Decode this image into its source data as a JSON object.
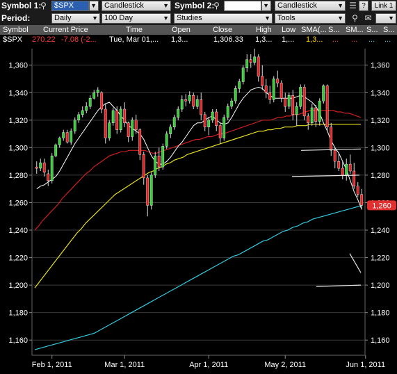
{
  "toolbar": {
    "symbol1_label": "Symbol 1:",
    "symbol1_value": "$SPX",
    "chart_type1": "Candlestick",
    "symbol2_label": "Symbol 2:",
    "symbol2_value": "",
    "chart_type2": "Candlestick",
    "link_label": "Link 1",
    "help_label": "?",
    "period_label": "Period:",
    "period_value": "Daily",
    "range_value": "100 Day",
    "studies_value": "Studies",
    "tools_value": "Tools"
  },
  "quote_header": [
    "Symbol",
    "Current Price",
    "Time",
    "Open",
    "Close",
    "High",
    "Low",
    "SMA(...",
    "S...",
    "SM...",
    "S...",
    "S..."
  ],
  "quote_row": {
    "symbol": "$SPX",
    "price": "270.22",
    "change": "-7.08 (-2...",
    "time": "Tue, Mar 01,...",
    "open": "1,3...",
    "close": "1,306.33",
    "high": "1,3...",
    "low": "1,...",
    "sma": "1,3...",
    "s1": "...",
    "sm": "...",
    "s2": "...",
    "s3": "..."
  },
  "colors": {
    "up": "#33cc33",
    "down": "#e02020",
    "sma_white": "#ffffff",
    "sma_red": "#cc1f1f",
    "sma_yellow": "#e6e020",
    "sma_cyan": "#33cce0",
    "price_tag": "#e03030",
    "negative_text": "#ff3b3b",
    "sma_header_text": "#ffd000"
  },
  "chart_data": {
    "type": "candlestick",
    "y_ticks": [
      1160,
      1180,
      1200,
      1220,
      1240,
      1260,
      1280,
      1300,
      1320,
      1340,
      1360
    ],
    "y_tick_labels": [
      "1,160",
      "1,180",
      "1,200",
      "1,220",
      "1,240",
      "1,260",
      "1,280",
      "1,300",
      "1,320",
      "1,340",
      "1,360"
    ],
    "ylim": [
      1150,
      1372
    ],
    "grid": true,
    "x_tick_labels": [
      {
        "label": "Feb 1, 2011",
        "bar": 4
      },
      {
        "label": "Mar 1, 2011",
        "bar": 23
      },
      {
        "label": "Apr 1, 2011",
        "bar": 45
      },
      {
        "label": "May 2, 2011",
        "bar": 65
      },
      {
        "label": "Jun 1, 2011",
        "bar": 86
      }
    ],
    "last_price_label": "1,260",
    "last_price": 1258,
    "candles": [
      [
        1286,
        1290,
        1281,
        1285
      ],
      [
        1285,
        1292,
        1283,
        1289
      ],
      [
        1289,
        1292,
        1279,
        1282
      ],
      [
        1281,
        1284,
        1272,
        1276
      ],
      [
        1276,
        1296,
        1274,
        1294
      ],
      [
        1294,
        1303,
        1293,
        1302
      ],
      [
        1302,
        1308,
        1300,
        1307
      ],
      [
        1307,
        1313,
        1305,
        1311
      ],
      [
        1311,
        1313,
        1303,
        1304
      ],
      [
        1304,
        1314,
        1302,
        1312
      ],
      [
        1312,
        1322,
        1310,
        1320
      ],
      [
        1320,
        1326,
        1318,
        1324
      ],
      [
        1324,
        1330,
        1322,
        1327
      ],
      [
        1327,
        1333,
        1325,
        1330
      ],
      [
        1330,
        1338,
        1328,
        1336
      ],
      [
        1336,
        1342,
        1335,
        1340
      ],
      [
        1340,
        1344,
        1337,
        1342
      ],
      [
        1340,
        1341,
        1325,
        1328
      ],
      [
        1328,
        1332,
        1303,
        1307
      ],
      [
        1307,
        1320,
        1305,
        1318
      ],
      [
        1318,
        1329,
        1316,
        1327
      ],
      [
        1327,
        1330,
        1310,
        1313
      ],
      [
        1313,
        1330,
        1311,
        1328
      ],
      [
        1328,
        1333,
        1315,
        1318
      ],
      [
        1318,
        1319,
        1304,
        1308
      ],
      [
        1308,
        1322,
        1305,
        1320
      ],
      [
        1320,
        1324,
        1310,
        1313
      ],
      [
        1313,
        1314,
        1291,
        1295
      ],
      [
        1295,
        1297,
        1273,
        1278
      ],
      [
        1278,
        1280,
        1250,
        1258
      ],
      [
        1258,
        1282,
        1255,
        1280
      ],
      [
        1280,
        1297,
        1278,
        1294
      ],
      [
        1294,
        1300,
        1283,
        1286
      ],
      [
        1286,
        1303,
        1284,
        1301
      ],
      [
        1301,
        1312,
        1299,
        1310
      ],
      [
        1310,
        1317,
        1307,
        1315
      ],
      [
        1315,
        1324,
        1313,
        1322
      ],
      [
        1322,
        1330,
        1320,
        1328
      ],
      [
        1328,
        1338,
        1326,
        1335
      ],
      [
        1335,
        1339,
        1330,
        1334
      ],
      [
        1334,
        1341,
        1332,
        1338
      ],
      [
        1338,
        1340,
        1328,
        1330
      ],
      [
        1330,
        1338,
        1328,
        1335
      ],
      [
        1335,
        1340,
        1320,
        1324
      ],
      [
        1324,
        1326,
        1312,
        1315
      ],
      [
        1315,
        1322,
        1309,
        1320
      ],
      [
        1320,
        1328,
        1318,
        1326
      ],
      [
        1326,
        1328,
        1312,
        1316
      ],
      [
        1316,
        1318,
        1303,
        1307
      ],
      [
        1307,
        1324,
        1305,
        1322
      ],
      [
        1322,
        1332,
        1320,
        1330
      ],
      [
        1330,
        1336,
        1328,
        1334
      ],
      [
        1334,
        1345,
        1332,
        1343
      ],
      [
        1343,
        1350,
        1340,
        1348
      ],
      [
        1348,
        1360,
        1346,
        1358
      ],
      [
        1358,
        1368,
        1355,
        1364
      ],
      [
        1364,
        1368,
        1358,
        1362
      ],
      [
        1362,
        1372,
        1360,
        1366
      ],
      [
        1366,
        1368,
        1348,
        1352
      ],
      [
        1352,
        1360,
        1342,
        1345
      ],
      [
        1345,
        1350,
        1336,
        1340
      ],
      [
        1340,
        1345,
        1332,
        1335
      ],
      [
        1335,
        1352,
        1333,
        1350
      ],
      [
        1350,
        1356,
        1344,
        1347
      ],
      [
        1347,
        1349,
        1333,
        1336
      ],
      [
        1336,
        1340,
        1326,
        1330
      ],
      [
        1330,
        1340,
        1328,
        1338
      ],
      [
        1338,
        1342,
        1320,
        1324
      ],
      [
        1324,
        1333,
        1316,
        1330
      ],
      [
        1330,
        1346,
        1328,
        1344
      ],
      [
        1344,
        1346,
        1320,
        1323
      ],
      [
        1323,
        1325,
        1313,
        1318
      ],
      [
        1318,
        1332,
        1316,
        1329
      ],
      [
        1329,
        1331,
        1315,
        1319
      ],
      [
        1319,
        1336,
        1316,
        1334
      ],
      [
        1334,
        1346,
        1332,
        1345
      ],
      [
        1345,
        1346,
        1312,
        1315
      ],
      [
        1315,
        1318,
        1294,
        1298
      ],
      [
        1298,
        1300,
        1285,
        1290
      ],
      [
        1290,
        1296,
        1283,
        1285
      ],
      [
        1285,
        1290,
        1277,
        1280
      ],
      [
        1280,
        1292,
        1276,
        1288
      ],
      [
        1288,
        1295,
        1281,
        1283
      ],
      [
        1283,
        1289,
        1270,
        1272
      ],
      [
        1272,
        1275,
        1264,
        1266
      ],
      [
        1266,
        1270,
        1256,
        1258
      ]
    ],
    "sma_white": [
      1270,
      1272,
      1273,
      1275,
      1277,
      1279,
      1283,
      1288,
      1293,
      1298,
      1303,
      1307,
      1311,
      1315,
      1319,
      1323,
      1327,
      1330,
      1332,
      1333,
      1330,
      1327,
      1323,
      1320,
      1316,
      1314,
      1312,
      1310,
      1306,
      1300,
      1294,
      1290,
      1288,
      1288,
      1290,
      1293,
      1297,
      1301,
      1304,
      1308,
      1312,
      1316,
      1318,
      1318,
      1320,
      1322,
      1323,
      1320,
      1318,
      1317,
      1318,
      1322,
      1327,
      1332,
      1336,
      1339,
      1342,
      1343,
      1344,
      1343,
      1340,
      1338,
      1336,
      1336,
      1336,
      1336,
      1336,
      1336,
      1337,
      1338,
      1337,
      1335,
      1333,
      1330,
      1325,
      1318,
      1312,
      1305,
      1300,
      1296,
      1290,
      1284,
      1276,
      1268,
      1262,
      1255
    ],
    "sma_red": [
      1240,
      1243,
      1247,
      1250,
      1253,
      1256,
      1259,
      1263,
      1266,
      1269,
      1272,
      1275,
      1278,
      1281,
      1283,
      1286,
      1288,
      1290,
      1292,
      1294,
      1295,
      1296,
      1297,
      1297,
      1298,
      1298,
      1298,
      1298,
      1298,
      1297,
      1296,
      1296,
      1297,
      1298,
      1299,
      1300,
      1301,
      1302,
      1303,
      1304,
      1305,
      1306,
      1306,
      1307,
      1308,
      1308,
      1309,
      1310,
      1310,
      1311,
      1312,
      1313,
      1314,
      1315,
      1316,
      1317,
      1318,
      1319,
      1320,
      1320,
      1320,
      1321,
      1322,
      1322,
      1323,
      1323,
      1324,
      1324,
      1325,
      1326,
      1327,
      1327,
      1327,
      1327,
      1327,
      1327,
      1327,
      1326,
      1326,
      1325,
      1325,
      1324,
      1323,
      1322
    ],
    "sma_yellow": [
      1198,
      1202,
      1206,
      1210,
      1214,
      1218,
      1222,
      1226,
      1230,
      1234,
      1238,
      1241,
      1245,
      1248,
      1251,
      1254,
      1257,
      1260,
      1263,
      1266,
      1268,
      1270,
      1272,
      1274,
      1276,
      1278,
      1280,
      1282,
      1283,
      1285,
      1286,
      1288,
      1289,
      1291,
      1292,
      1293,
      1295,
      1296,
      1297,
      1298,
      1299,
      1300,
      1301,
      1302,
      1303,
      1304,
      1305,
      1306,
      1307,
      1308,
      1309,
      1310,
      1311,
      1312,
      1312,
      1313,
      1313,
      1314,
      1314,
      1315,
      1315,
      1315,
      1316,
      1316,
      1316,
      1317,
      1317,
      1317,
      1317,
      1317,
      1317,
      1317,
      1317,
      1317,
      1317,
      1317,
      1317,
      1317
    ],
    "sma_cyan": [
      1153,
      1154,
      1155,
      1156,
      1157,
      1158,
      1159,
      1160,
      1161,
      1162,
      1163,
      1164,
      1165,
      1167,
      1169,
      1171,
      1173,
      1175,
      1177,
      1179,
      1181,
      1183,
      1185,
      1187,
      1189,
      1191,
      1193,
      1195,
      1197,
      1199,
      1201,
      1203,
      1205,
      1207,
      1209,
      1211,
      1213,
      1215,
      1217,
      1219,
      1221,
      1222,
      1224,
      1226,
      1228,
      1230,
      1232,
      1233,
      1235,
      1237,
      1239,
      1240,
      1242,
      1243,
      1245,
      1246,
      1248,
      1249,
      1250,
      1251,
      1252,
      1253,
      1254,
      1255,
      1256,
      1257,
      1258
    ]
  }
}
